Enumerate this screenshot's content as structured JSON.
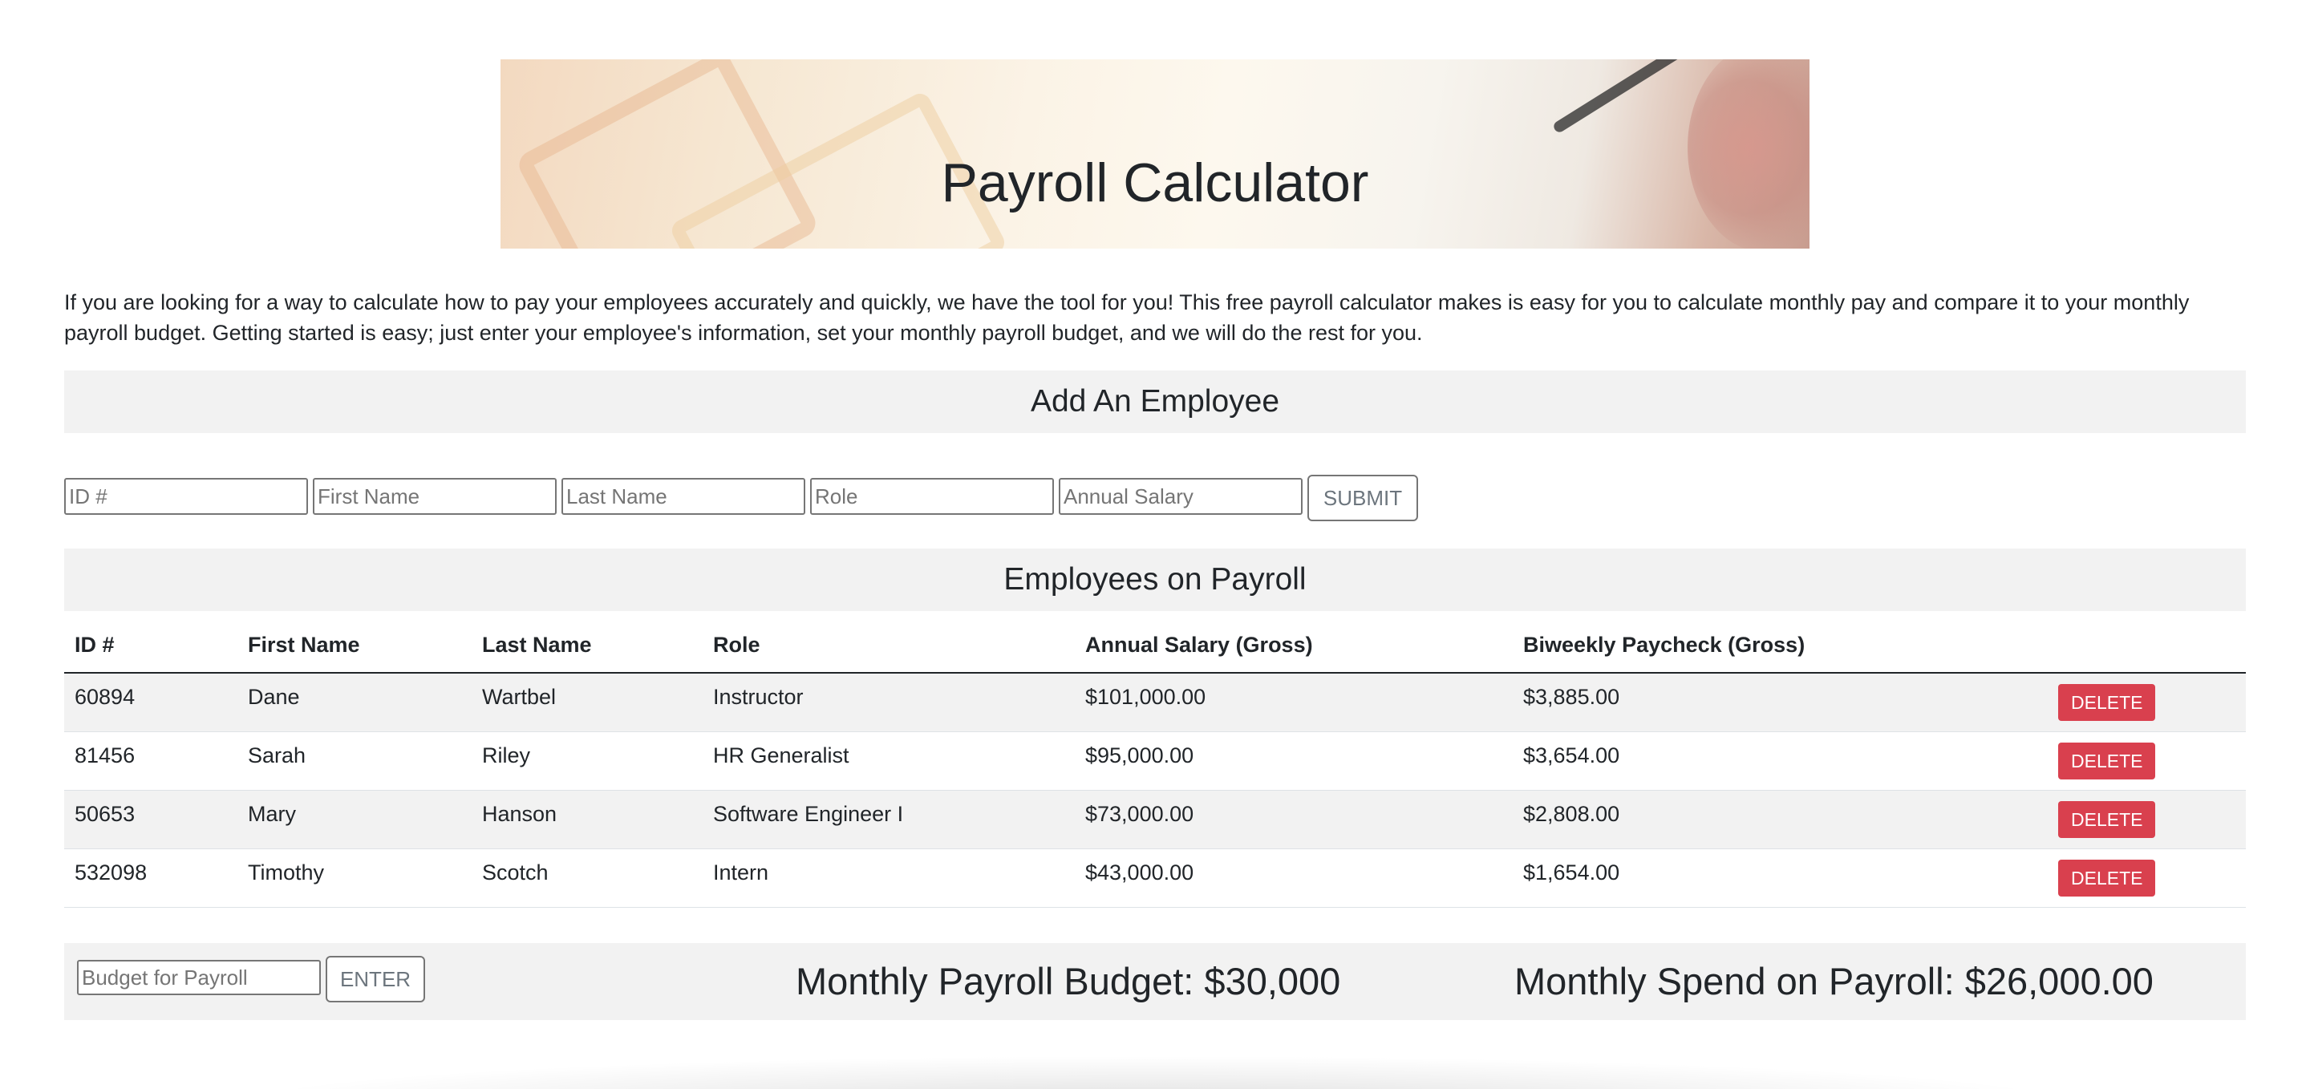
{
  "banner": {
    "title": "Payroll Calculator"
  },
  "intro": {
    "text": "If you are looking for a way to calculate how to pay your employees accurately and quickly, we have the tool for you! This free payroll calculator makes is easy for you to calculate monthly pay and compare it to your monthly payroll budget. Getting started is easy; just enter your employee's information, set your monthly payroll budget, and we will do the rest for you."
  },
  "add_employee": {
    "heading": "Add An Employee",
    "fields": {
      "id_placeholder": "ID #",
      "first_placeholder": "First Name",
      "last_placeholder": "Last Name",
      "role_placeholder": "Role",
      "salary_placeholder": "Annual Salary"
    },
    "submit_label": "SUBMIT"
  },
  "employees": {
    "heading": "Employees on Payroll",
    "columns": [
      "ID #",
      "First Name",
      "Last Name",
      "Role",
      "Annual Salary (Gross)",
      "Biweekly Paycheck (Gross)",
      ""
    ],
    "delete_label": "DELETE",
    "rows": [
      {
        "id": "60894",
        "first": "Dane",
        "last": "Wartbel",
        "role": "Instructor",
        "annual": "$101,000.00",
        "biweekly": "$3,885.00"
      },
      {
        "id": "81456",
        "first": "Sarah",
        "last": "Riley",
        "role": "HR Generalist",
        "annual": "$95,000.00",
        "biweekly": "$3,654.00"
      },
      {
        "id": "50653",
        "first": "Mary",
        "last": "Hanson",
        "role": "Software Engineer I",
        "annual": "$73,000.00",
        "biweekly": "$2,808.00"
      },
      {
        "id": "532098",
        "first": "Timothy",
        "last": "Scotch",
        "role": "Intern",
        "annual": "$43,000.00",
        "biweekly": "$1,654.00"
      }
    ]
  },
  "budget": {
    "input_placeholder": "Budget for Payroll",
    "enter_label": "ENTER",
    "monthly_budget_text": "Monthly Payroll Budget: $30,000",
    "monthly_spend_text": "Monthly Spend on Payroll: $26,000.00"
  },
  "colors": {
    "delete_button": "#d9404e",
    "section_background": "#f2f2f2",
    "text": "#212529"
  }
}
